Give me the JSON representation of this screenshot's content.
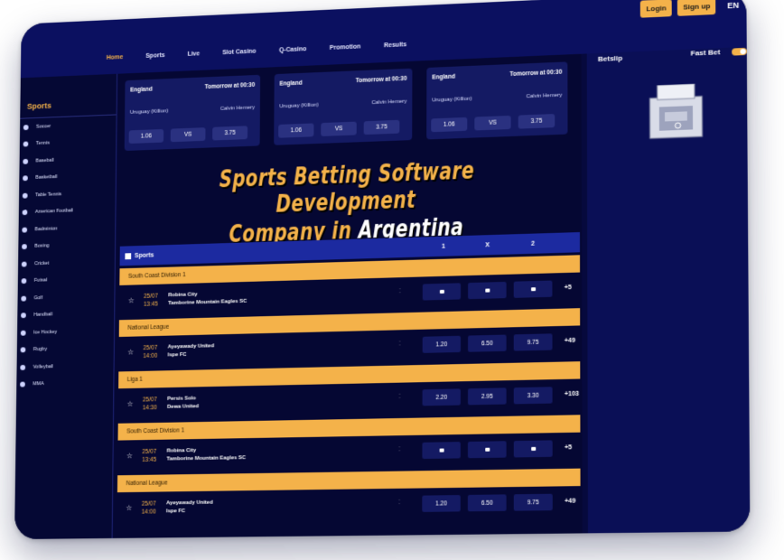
{
  "nav": {
    "items": [
      "Home",
      "Sports",
      "Live",
      "Slot Casino",
      "Q-Casino",
      "Promotion",
      "Results"
    ],
    "active": "Home"
  },
  "top": {
    "login": "Login",
    "signup": "Sign up",
    "lang": "EN"
  },
  "sidebar": {
    "title": "Sports",
    "items": [
      "Soccer",
      "Tennis",
      "Baseball",
      "Basketball",
      "Table Tennis",
      "American Football",
      "Badminton",
      "Boxing",
      "Cricket",
      "Futsal",
      "Golf",
      "Handball",
      "Ice Hockey",
      "Rugby",
      "Volleyball",
      "MMA"
    ]
  },
  "cards": [
    {
      "league": "England",
      "time": "Tomorrow at 00:30",
      "home": "Uruguay (Killion)",
      "away": "Calvin Hemery",
      "o1": "1.06",
      "ox": "VS",
      "o2": "3.75"
    },
    {
      "league": "England",
      "time": "Tomorrow at 00:30",
      "home": "Uruguay (Killion)",
      "away": "Calvin Hemery",
      "o1": "1.06",
      "ox": "VS",
      "o2": "3.75"
    },
    {
      "league": "England",
      "time": "Tomorrow at 00:30",
      "home": "Uruguay (Killion)",
      "away": "Calvin Hemery",
      "o1": "1.06",
      "ox": "VS",
      "o2": "3.75"
    }
  ],
  "hero": {
    "line1": "Sports Betting Software Development",
    "line2a": "Company in ",
    "line2b": "Argentina"
  },
  "table": {
    "title": "Sports",
    "c1": "1",
    "cx": "X",
    "c2": "2"
  },
  "rows": [
    {
      "league": "South Coast Division 1",
      "date": "25/07",
      "time": "13:45",
      "home": "Robina City",
      "away": "Tamborine Mountain Eagles SC",
      "locked": true,
      "o1": "",
      "ox": "",
      "o2": "",
      "more": "+5"
    },
    {
      "league": "National League",
      "date": "25/07",
      "time": "14:00",
      "home": "Ayeyawady United",
      "away": "Ispe FC",
      "locked": false,
      "o1": "1.20",
      "ox": "6.50",
      "o2": "9.75",
      "more": "+49"
    },
    {
      "league": "Liga 1",
      "date": "25/07",
      "time": "14:30",
      "home": "Persis Solo",
      "away": "Dewa United",
      "locked": false,
      "o1": "2.20",
      "ox": "2.95",
      "o2": "3.30",
      "more": "+103"
    },
    {
      "league": "South Coast Division 1",
      "date": "25/07",
      "time": "13:45",
      "home": "Robina City",
      "away": "Tamborine Mountain Eagles SC",
      "locked": true,
      "o1": "",
      "ox": "",
      "o2": "",
      "more": "+5"
    },
    {
      "league": "National League",
      "date": "25/07",
      "time": "14:00",
      "home": "Ayeyawady United",
      "away": "Ispe FC",
      "locked": false,
      "o1": "1.20",
      "ox": "6.50",
      "o2": "9.75",
      "more": "+49"
    }
  ],
  "betslip": {
    "title": "Betslip",
    "fastbet": "Fast Bet"
  },
  "colors": {
    "accent": "#f4b24a",
    "bg": "#06093d",
    "panel": "#141a63"
  }
}
